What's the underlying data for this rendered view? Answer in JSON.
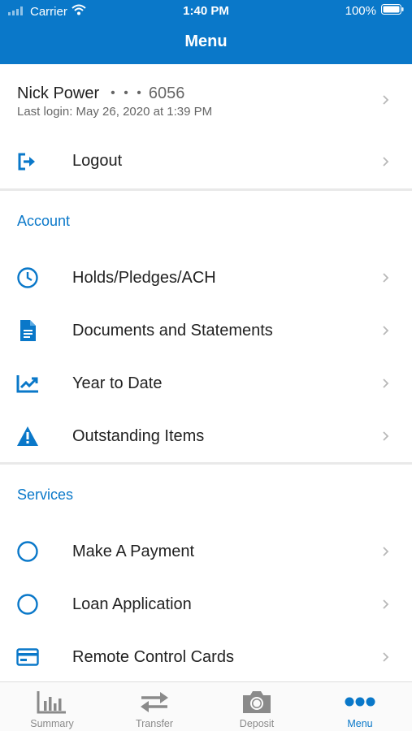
{
  "status_bar": {
    "carrier": "Carrier",
    "time": "1:40 PM",
    "battery": "100%"
  },
  "header": {
    "title": "Menu"
  },
  "profile": {
    "name": "Nick Power",
    "mask": "• • •",
    "account_suffix": "6056",
    "last_login": "Last login: May 26, 2020 at 1:39 PM"
  },
  "logout": {
    "label": "Logout"
  },
  "account_section": {
    "title": "Account",
    "items": [
      {
        "label": "Holds/Pledges/ACH",
        "icon": "clock-icon"
      },
      {
        "label": "Documents and Statements",
        "icon": "document-icon"
      },
      {
        "label": "Year to Date",
        "icon": "trend-chart-icon"
      },
      {
        "label": "Outstanding Items",
        "icon": "warning-icon"
      }
    ]
  },
  "services_section": {
    "title": "Services",
    "items": [
      {
        "label": "Make A Payment",
        "icon": "circle-icon"
      },
      {
        "label": "Loan Application",
        "icon": "circle-icon"
      },
      {
        "label": "Remote Control Cards",
        "icon": "card-icon"
      }
    ]
  },
  "tabs": [
    {
      "label": "Summary",
      "icon": "bar-chart-icon",
      "active": false
    },
    {
      "label": "Transfer",
      "icon": "transfer-arrows-icon",
      "active": false
    },
    {
      "label": "Deposit",
      "icon": "camera-icon",
      "active": false
    },
    {
      "label": "Menu",
      "icon": "more-dots-icon",
      "active": true
    }
  ],
  "colors": {
    "accent": "#0a78c9",
    "text": "#222222",
    "muted": "#8a8a8a",
    "divider": "#e9e9e9"
  }
}
